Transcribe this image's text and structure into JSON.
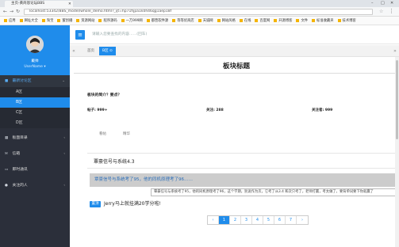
{
  "browser": {
    "tab_title": "主页-黄商恩论坛BBS",
    "url": "localhost:53342/BBS_model/whole_demo.html?_ijt=hp71fijpa1k0h46qg1aep18f",
    "bookmarks": [
      "应用",
      "网址大全",
      "淘宝",
      "蜜创播",
      "资源网站",
      "程序源码",
      "一万999网",
      "都营软件源",
      "等等优商店",
      "天诚网",
      "网站风格",
      "在线",
      "百度网",
      "开源博客",
      "文件",
      "标准收藏夹",
      "技术博客"
    ]
  },
  "sidebar": {
    "username": "戴帅",
    "user_status": "UserName ▾",
    "items": [
      {
        "label": "最新讨论区",
        "icon": "bookmark-icon"
      },
      {
        "label": "A区"
      },
      {
        "label": "B区"
      },
      {
        "label": "C区"
      },
      {
        "label": "D区"
      },
      {
        "label": "板面目录",
        "icon": "grid-icon"
      },
      {
        "label": "信箱",
        "icon": "mail-icon"
      },
      {
        "label": "即时通讯",
        "icon": "chat-icon"
      },
      {
        "label": "关注的人",
        "icon": "user-icon"
      }
    ]
  },
  "topbar": {
    "search_placeholder": "请输入您要查找的内容……(回车)"
  },
  "page_tabs": {
    "home": "首页",
    "current": "B区 ⊙"
  },
  "board": {
    "title": "板块标题",
    "intro": "板块的简介？要点？",
    "stats": {
      "posts": "帖子: 999+",
      "follows": "关注: 288",
      "focus": "关注者: 999"
    },
    "filters": [
      "看帖",
      "精华"
    ],
    "threads": [
      {
        "title": "覃豪信号与系统4.3"
      },
      {
        "title": "覃豪信号与系统考了95，他的同机原理考了96……"
      }
    ],
    "tooltip": "覃豪信号与系统考了95，他的同机原理考了96，这个学期，别说作为次，它考了从3.4 和次只考了，老师打赢，考太做了，要背单词要下你就赢了",
    "sticky": {
      "badge": "置顶",
      "title": "Jerry马上就挂满20学分啦!"
    }
  },
  "pagination": {
    "prev": "‹",
    "pages": [
      "1",
      "2",
      "3",
      "4",
      "5",
      "6",
      "7"
    ],
    "next": "›",
    "active": "1"
  }
}
